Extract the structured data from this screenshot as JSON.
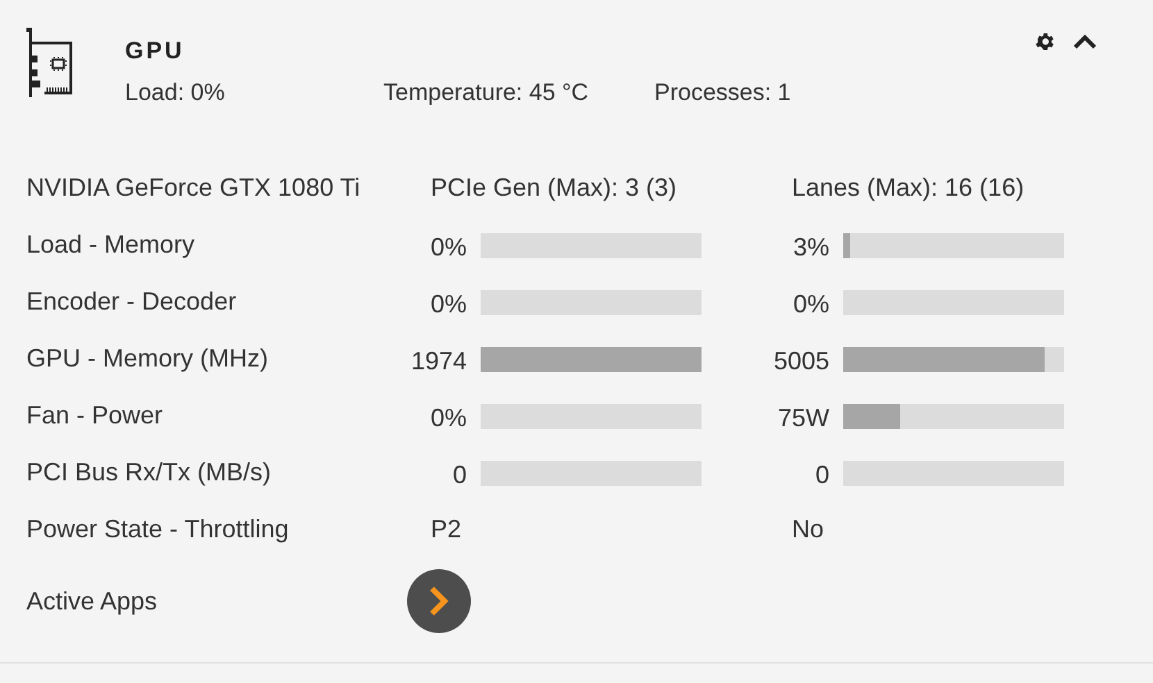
{
  "header": {
    "title": "GPU",
    "stats": [
      "Load: 0%",
      "Temperature: 45 °C",
      "Processes: 1"
    ],
    "expanded": true
  },
  "rows": [
    {
      "kind": "text",
      "label": "NVIDIA GeForce GTX 1080 Ti",
      "values": [
        "PCIe Gen (Max): 3 (3)",
        "Lanes (Max): 16 (16)"
      ]
    },
    {
      "kind": "bars",
      "label": "Load - Memory",
      "values": [
        {
          "reading": "0%",
          "level": 0
        },
        {
          "reading": "3%",
          "level": 0.03
        }
      ]
    },
    {
      "kind": "bars",
      "label": "Encoder - Decoder",
      "values": [
        {
          "reading": "0%",
          "level": 0
        },
        {
          "reading": "0%",
          "level": 0
        }
      ]
    },
    {
      "kind": "bars",
      "label": "GPU - Memory (MHz)",
      "values": [
        {
          "reading": "1974",
          "level": 1
        },
        {
          "reading": "5005",
          "level": 0.91
        }
      ]
    },
    {
      "kind": "bars",
      "label": "Fan - Power",
      "values": [
        {
          "reading": "0%",
          "level": 0
        },
        {
          "reading": "75W",
          "level": 0.26
        }
      ]
    },
    {
      "kind": "bars",
      "label": "PCI Bus Rx/Tx (MB/s)",
      "values": [
        {
          "reading": "0",
          "level": 0
        },
        {
          "reading": "0",
          "level": 0
        }
      ]
    },
    {
      "kind": "text",
      "label": "Power State - Throttling",
      "values": [
        "P2",
        "No"
      ]
    }
  ],
  "active_apps": {
    "label": "Active Apps"
  }
}
